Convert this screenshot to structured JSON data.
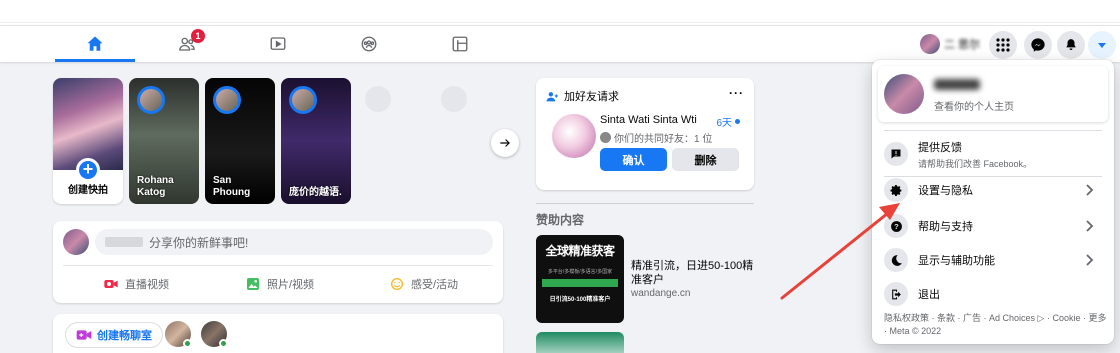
{
  "nav": {
    "tabs": [
      {
        "name": "home",
        "active": true
      },
      {
        "name": "friends",
        "badge": "1"
      },
      {
        "name": "watch"
      },
      {
        "name": "groups"
      },
      {
        "name": "gaming"
      }
    ],
    "profile_name": "二 思尔"
  },
  "stories": {
    "create_label": "创建快拍",
    "items": [
      {
        "label": "Rohana Katog"
      },
      {
        "label": "San Phoung"
      },
      {
        "label": "庞价的越语."
      }
    ]
  },
  "composer": {
    "placeholder": "分享你的新鲜事吧!",
    "actions": {
      "live": "直播视频",
      "photo": "照片/视频",
      "feeling": "感受/活动"
    }
  },
  "room": {
    "button_label": "创建畅聊室"
  },
  "friend_requests": {
    "header": "加好友请求",
    "more": "···",
    "name": "Sinta Wati Sinta Wti",
    "days": "6天",
    "mutual": "你们的共同好友：1 位",
    "confirm": "确认",
    "delete": "删除"
  },
  "sponsored": {
    "title": "赞助内容",
    "ad": {
      "image_title": "全球精准获客",
      "image_subtitle": "多平台/多模板/多语言/多国家",
      "image_cta": "日引流50-100精准客户",
      "text": "精准引流，日进50-100精准客户",
      "domain": "wandange.cn"
    }
  },
  "account_menu": {
    "profile_name": "二 思尔",
    "profile_sub": "查看你的个人主页",
    "feedback_title": "提供反馈",
    "feedback_sub": "请帮助我们改善 Facebook。",
    "items": [
      {
        "label": "设置与隐私"
      },
      {
        "label": "帮助与支持"
      },
      {
        "label": "显示与辅助功能"
      },
      {
        "label": "退出"
      }
    ],
    "footer": "隐私权政策 · 条款 · 广告 · Ad Choices ▷ · Cookie · 更多 · Meta © 2022"
  },
  "colors": {
    "brand": "#1877f2",
    "annotation_arrow": "#e8423a"
  }
}
